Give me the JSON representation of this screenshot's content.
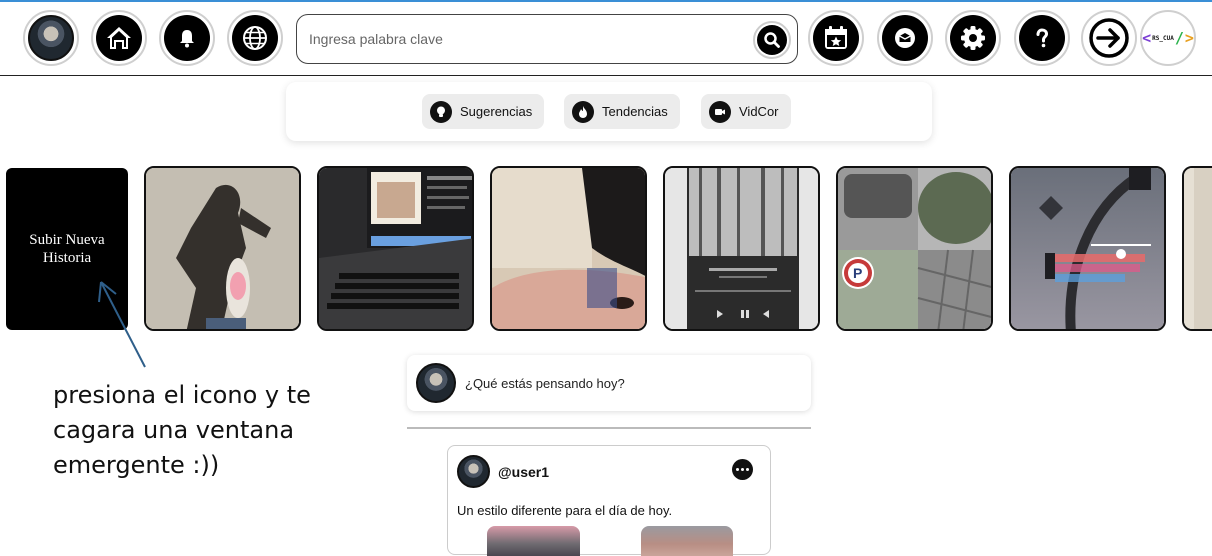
{
  "topbar": {
    "buttons": [
      {
        "name": "profile-avatar",
        "icon": "avatar"
      },
      {
        "name": "home",
        "icon": "home-icon"
      },
      {
        "name": "notifications",
        "icon": "bell-icon"
      },
      {
        "name": "explore",
        "icon": "globe-icon"
      },
      {
        "name": "events",
        "icon": "calendar-star-icon"
      },
      {
        "name": "messages",
        "icon": "envelope-icon"
      },
      {
        "name": "settings",
        "icon": "gear-icon"
      },
      {
        "name": "help",
        "icon": "question-icon"
      },
      {
        "name": "logout",
        "icon": "logout-arrow-icon"
      }
    ],
    "logo": {
      "main": "</>",
      "tag": "RS_CUA"
    }
  },
  "search": {
    "placeholder": "Ingresa palabra clave",
    "value": ""
  },
  "tabs": [
    {
      "label": "Sugerencias",
      "icon": "lightbulb-icon"
    },
    {
      "label": "Tendencias",
      "icon": "flame-icon"
    },
    {
      "label": "VidCor",
      "icon": "video-camera-icon"
    }
  ],
  "stories": {
    "upload_label": "Subir Nueva Historia",
    "items": [
      "story-shadow-photo",
      "story-laptop-music",
      "story-selfie",
      "story-music-player-forest",
      "story-collage-parking",
      "story-traffic-light",
      "story-partial"
    ]
  },
  "annotation": {
    "text": "presiona el icono y te cagara una ventana emergente :))"
  },
  "composer": {
    "placeholder": "¿Qué estás pensando hoy?"
  },
  "post": {
    "username": "@user1",
    "text": "Un estilo diferente para el día de hoy."
  },
  "colors": {
    "accent_line": "#3a8fd6",
    "icon_bg": "#000000",
    "tab_bg": "#ececec"
  }
}
